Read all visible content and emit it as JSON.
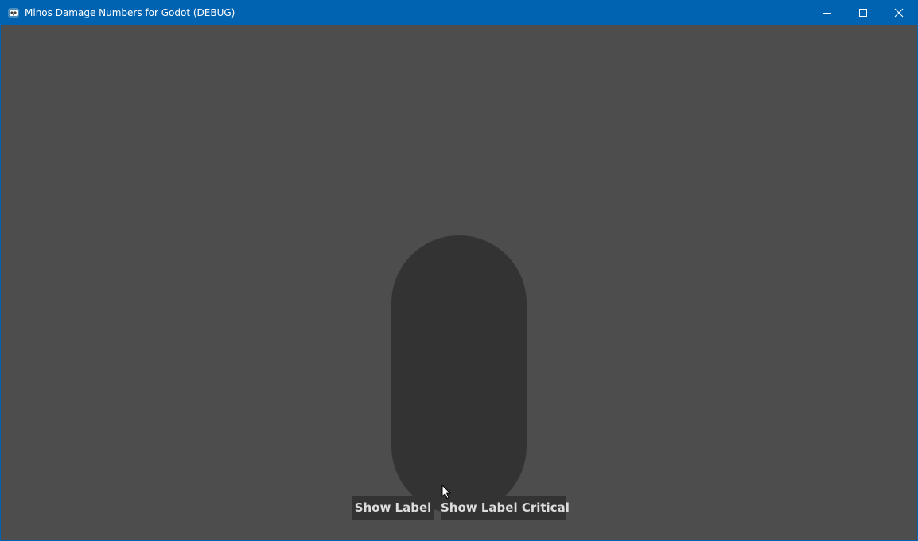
{
  "window": {
    "title": "Minos Damage Numbers for Godot (DEBUG)",
    "app_icon": "godot-icon",
    "controls": {
      "minimize_icon": "minimize-icon",
      "maximize_icon": "maximize-icon",
      "close_icon": "close-icon"
    },
    "titlebar_color": "#0063b1"
  },
  "scene": {
    "background_color": "#4d4d4d",
    "capsule_color": "#333333",
    "buttons": [
      {
        "label": "Show Label"
      },
      {
        "label": "Show Label Critical"
      }
    ],
    "cursor_icon": "mouse-pointer-icon"
  }
}
